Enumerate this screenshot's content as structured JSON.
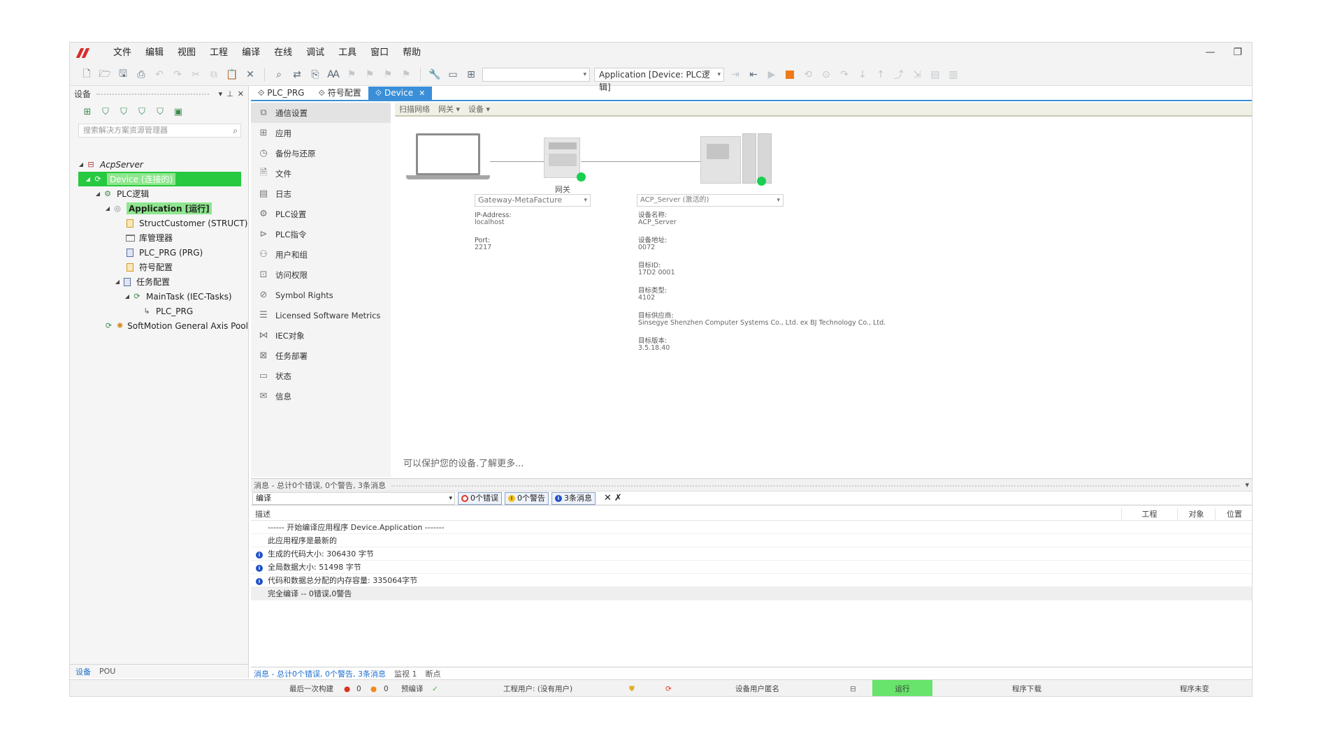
{
  "menu": [
    "文件",
    "编辑",
    "视图",
    "工程",
    "编译",
    "在线",
    "调试",
    "工具",
    "窗口",
    "帮助"
  ],
  "toolbar": {
    "app_combo": "Application [Device: PLC逻辑]"
  },
  "left_panel": {
    "title": "设备",
    "search_placeholder": "搜索解决方案资源管理器",
    "tree": {
      "root": "AcpServer",
      "device": "Device (连接的)",
      "plc_logic": "PLC逻辑",
      "application": "Application [运行]",
      "struct": "StructCustomer (STRUCT)",
      "library": "库管理器",
      "plc_prg": "PLC_PRG (PRG)",
      "symbol": "符号配置",
      "task_config": "任务配置",
      "main_task": "MainTask (IEC-Tasks)",
      "plc_prg_call": "PLC_PRG",
      "softmotion": "SoftMotion General Axis Pool"
    },
    "bottom_tabs": [
      "设备",
      "POU"
    ]
  },
  "editor_tabs": [
    "PLC_PRG",
    "符号配置",
    "Device"
  ],
  "device_nav": [
    "通信设置",
    "应用",
    "备份与还原",
    "文件",
    "日志",
    "PLC设置",
    "PLC指令",
    "用户和组",
    "访问权限",
    "Symbol Rights",
    "Licensed Software Metrics",
    "IEC对象",
    "任务部署",
    "状态",
    "信息"
  ],
  "device_bar": [
    "扫描网络",
    "网关 ▾",
    "设备 ▾"
  ],
  "gateway": {
    "label": "网关",
    "combo": "Gateway-MetaFacture",
    "ip_label": "IP-Address:",
    "ip_value": "localhost",
    "port_label": "Port:",
    "port_value": "2217"
  },
  "server": {
    "combo": "ACP_Server (激活的)",
    "name_label": "设备名称:",
    "name_value": "ACP_Server",
    "addr_label": "设备地址:",
    "addr_value": "0072",
    "target_id_label": "目标ID:",
    "target_id_value": "17D2 0001",
    "target_type_label": "目标类型:",
    "target_type_value": "4102",
    "vendor_label": "目标供应商:",
    "vendor_value": "Sinsegye Shenzhen Computer Systems Co., Ltd. ex BJ Technology Co., Ltd.",
    "version_label": "目标版本:",
    "version_value": "3.5.18.40"
  },
  "protect_text": "可以保护您的设备.了解更多...",
  "messages": {
    "title": "消息 - 总计0个错误, 0个警告, 3条消息",
    "source": "编译",
    "filter_errors": "0个错误",
    "filter_warnings": "0个警告",
    "filter_messages": "3条消息",
    "columns": [
      "描述",
      "工程",
      "对象",
      "位置"
    ],
    "rows": [
      {
        "icon": "",
        "text": "------ 开始编译应用程序 Device.Application -------"
      },
      {
        "icon": "",
        "text": "此应用程序是最新的"
      },
      {
        "icon": "i",
        "text": "生成的代码大小: 306430 字节"
      },
      {
        "icon": "i",
        "text": "全局数据大小: 51498 字节"
      },
      {
        "icon": "i",
        "text": "代码和数据总分配的内存容量: 335064字节"
      },
      {
        "icon": "",
        "text": "完全编译 -- 0错误,0警告"
      }
    ],
    "bottom_tabs": [
      "消息 - 总计0个错误, 0个警告, 3条消息",
      "监视 1",
      "断点"
    ]
  },
  "status": {
    "last_build": "最后一次构建",
    "err_count": "0",
    "warn_count": "0",
    "precompile": "预编译",
    "project_user": "工程用户: (没有用户)",
    "device_user": "设备用户匿名",
    "run": "运行",
    "download": "程序下载",
    "unchanged": "程序未变"
  }
}
